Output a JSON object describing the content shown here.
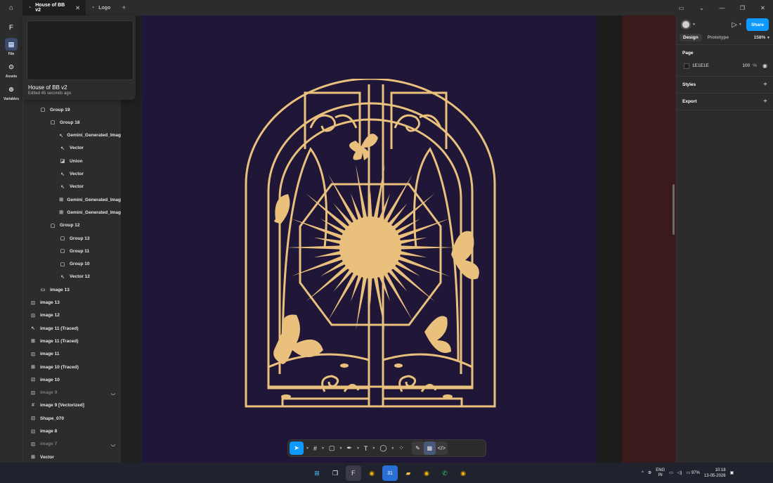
{
  "tabs": [
    {
      "label": "House of BB v2",
      "active": true
    },
    {
      "label": "Logo",
      "active": false
    }
  ],
  "window_controls": [
    "▭",
    "⌄",
    "—",
    "❐",
    "✕"
  ],
  "left_rail": [
    {
      "label": "File",
      "icon": "file-icon"
    },
    {
      "label": "Assets",
      "icon": "assets-icon"
    },
    {
      "label": "Variables",
      "icon": "variables-icon"
    }
  ],
  "file_card": {
    "title": "House of BB v2",
    "subtitle": "Edited 45 seconds ago"
  },
  "layers": [
    {
      "name": "Group 19",
      "indent": 1,
      "icon": "frame"
    },
    {
      "name": "Group 18",
      "indent": 2,
      "icon": "frame"
    },
    {
      "name": "Gemini_Generated_Imag",
      "indent": 3,
      "icon": "vector"
    },
    {
      "name": "Vector",
      "indent": 3,
      "icon": "vector"
    },
    {
      "name": "Union",
      "indent": 3,
      "icon": "union"
    },
    {
      "name": "Vector",
      "indent": 3,
      "icon": "vector"
    },
    {
      "name": "Vector",
      "indent": 3,
      "icon": "vector"
    },
    {
      "name": "Gemini_Generated_Imag",
      "indent": 3,
      "icon": "hash"
    },
    {
      "name": "Gemini_Generated_Imag",
      "indent": 3,
      "icon": "hash"
    },
    {
      "name": "Group 12",
      "indent": 2,
      "icon": "frame"
    },
    {
      "name": "Group 13",
      "indent": 3,
      "icon": "frame"
    },
    {
      "name": "Group 11",
      "indent": 3,
      "icon": "frame"
    },
    {
      "name": "Group 10",
      "indent": 3,
      "icon": "frame"
    },
    {
      "name": "Vector 12",
      "indent": 3,
      "icon": "vector"
    },
    {
      "name": "image 13",
      "indent": 1,
      "icon": "rect"
    },
    {
      "name": "image 13",
      "indent": 0,
      "icon": "image"
    },
    {
      "name": "image 12",
      "indent": 0,
      "icon": "image"
    },
    {
      "name": "image 11 (Traced)",
      "indent": 0,
      "icon": "vector"
    },
    {
      "name": "image 11 (Traced)",
      "indent": 0,
      "icon": "hash"
    },
    {
      "name": "image 11",
      "indent": 0,
      "icon": "image"
    },
    {
      "name": "image 10 (Traced)",
      "indent": 0,
      "icon": "hash"
    },
    {
      "name": "image 10",
      "indent": 0,
      "icon": "image"
    },
    {
      "name": "image 9",
      "indent": 0,
      "icon": "image",
      "hidden": true
    },
    {
      "name": "image 9 [Vectorized]",
      "indent": 0,
      "icon": "grid"
    },
    {
      "name": "Shape_070",
      "indent": 0,
      "icon": "image"
    },
    {
      "name": "image 8",
      "indent": 0,
      "icon": "image"
    },
    {
      "name": "image 7",
      "indent": 0,
      "icon": "image",
      "hidden": true
    },
    {
      "name": "Vector",
      "indent": 0,
      "icon": "hash"
    }
  ],
  "toolbar": {
    "tools": [
      {
        "name": "move-tool",
        "glyph": "➤",
        "active": true,
        "caret": true
      },
      {
        "name": "frame-tool",
        "glyph": "#",
        "caret": true
      },
      {
        "name": "shape-tool",
        "glyph": "▢",
        "caret": true
      },
      {
        "name": "pen-tool",
        "glyph": "✒",
        "caret": true
      },
      {
        "name": "text-tool",
        "glyph": "T",
        "caret": true
      },
      {
        "name": "comment-tool",
        "glyph": "◯",
        "caret": true
      },
      {
        "name": "actions-tool",
        "glyph": "⁘",
        "caret": false
      }
    ],
    "modes": [
      {
        "name": "draw-mode",
        "glyph": "✎"
      },
      {
        "name": "design-mode",
        "glyph": "▦",
        "selected": true
      },
      {
        "name": "dev-mode",
        "glyph": "</>"
      }
    ]
  },
  "right_panel": {
    "share_label": "Share",
    "tabs": [
      {
        "label": "Design",
        "active": true
      },
      {
        "label": "Prototype",
        "active": false
      }
    ],
    "zoom": "158%",
    "page": {
      "title": "Page",
      "color": "1E1E1E",
      "opacity": "100",
      "pct": "%"
    },
    "styles_title": "Styles",
    "export_title": "Export"
  },
  "taskbar": {
    "lang": "ENG",
    "region": "IN",
    "battery": "97%",
    "time": "10:18",
    "date": "13-05-2026",
    "calendar_day": "31"
  },
  "colors": {
    "artwork_gold": "#e9c07c",
    "frame_bg": "#1f1638",
    "accent": "#0d99ff"
  }
}
